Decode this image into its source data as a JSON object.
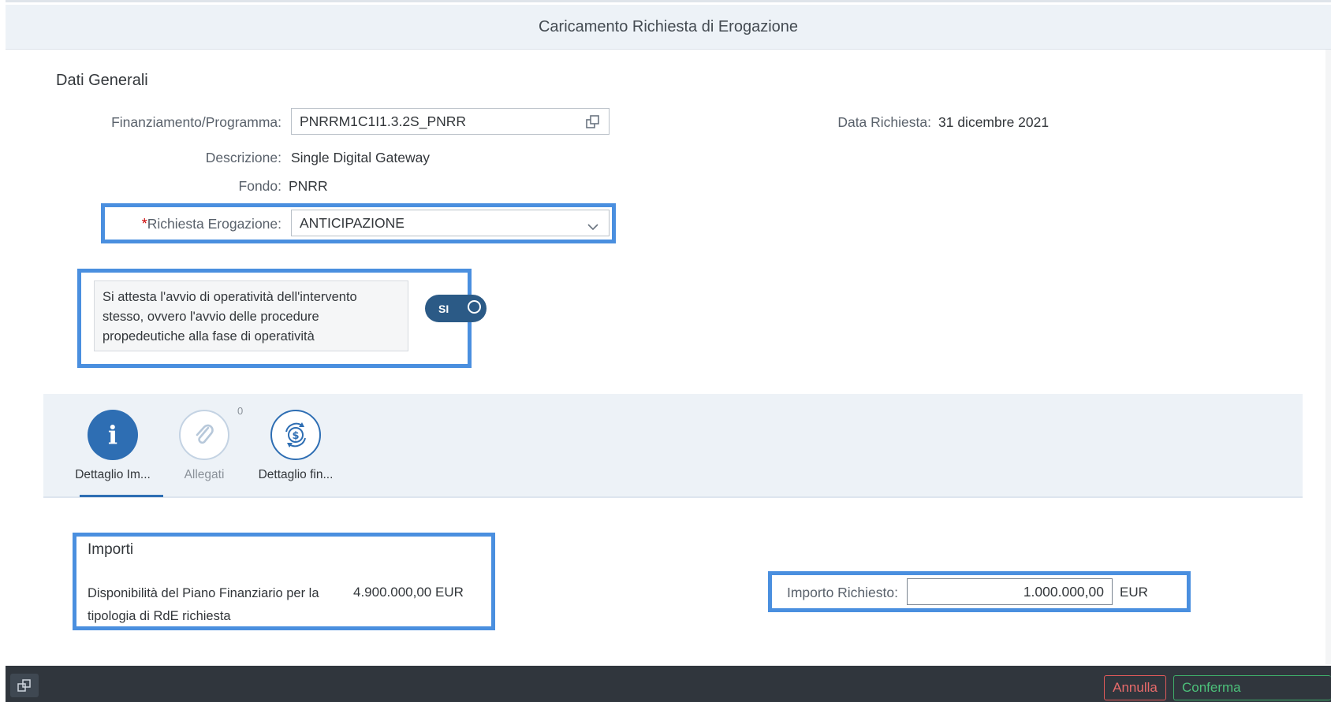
{
  "dialog": {
    "title": "Caricamento Richiesta di Erogazione"
  },
  "general": {
    "section_title": "Dati Generali",
    "finanziamento_label": "Finanziamento/Programma:",
    "finanziamento_value": "PNRRM1C1I1.3.2S_PNRR",
    "descrizione_label": "Descrizione:",
    "descrizione_value": "Single Digital Gateway",
    "fondo_label": "Fondo:",
    "fondo_value": "PNRR",
    "richiesta_required_mark": "*",
    "richiesta_label": "Richiesta Erogazione:",
    "richiesta_value": "ANTICIPAZIONE",
    "data_label": "Data Richiesta:",
    "data_value": "31 dicembre 2021"
  },
  "attestation": {
    "text": "Si attesta l'avvio di operatività dell'intervento stesso, ovvero l'avvio delle procedure propedeutiche alla fase di operatività",
    "toggle_label": "SI",
    "toggle_on": true
  },
  "tabs": [
    {
      "label": "Dettaglio Im...",
      "icon": "info-icon",
      "selected": true
    },
    {
      "label": "Allegati",
      "icon": "paperclip-icon",
      "count": "0",
      "selected": false
    },
    {
      "label": "Dettaglio fin...",
      "icon": "money-exchange-icon",
      "selected": false
    }
  ],
  "importi": {
    "title": "Importi",
    "disponibilita_label": "Disponibilità del Piano Finanziario per la tipologia di RdE richiesta",
    "disponibilita_value": "4.900.000,00 EUR",
    "importo_label": "Importo Richiesto:",
    "importo_value": "1.000.000,00",
    "importo_currency": "EUR"
  },
  "footer": {
    "annulla_label": "Annulla",
    "conferma_label": "Conferma"
  },
  "colors": {
    "highlight": "#4a8fdf",
    "toggle": "#2b5a86",
    "annulla": "#e05a5a",
    "conferma": "#3fae6a"
  }
}
